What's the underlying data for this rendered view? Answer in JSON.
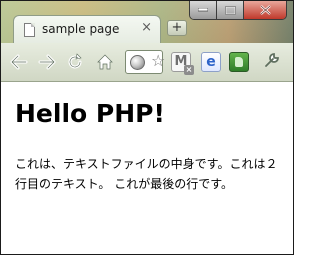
{
  "window": {
    "caption_buttons": [
      "minimize",
      "maximize",
      "close"
    ]
  },
  "tab": {
    "title": "sample page",
    "icon": "page-icon",
    "close_glyph": "×"
  },
  "new_tab": {
    "glyph": "+"
  },
  "toolbar": {
    "icons": [
      "back-arrow-icon",
      "forward-arrow-icon",
      "reload-icon",
      "home-icon",
      "globe-icon",
      "star-icon",
      "gmail-extension-icon",
      "ie-extension-icon",
      "evernote-extension-icon",
      "wrench-icon"
    ]
  },
  "page": {
    "heading": "Hello PHP!",
    "paragraph": "これは、テキストファイルの中身です。これは２行目のテキスト。 これが最後の行です。"
  }
}
